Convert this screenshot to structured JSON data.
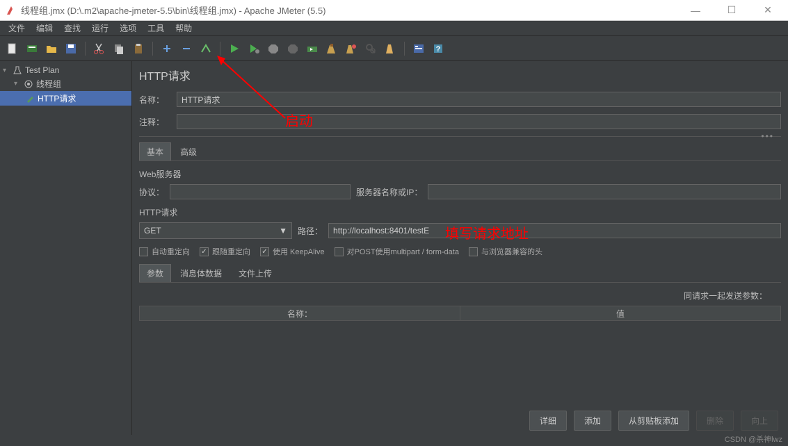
{
  "window": {
    "title": "线程组.jmx (D:\\.m2\\apache-jmeter-5.5\\bin\\线程组.jmx) - Apache JMeter (5.5)"
  },
  "menu": {
    "file": "文件",
    "edit": "编辑",
    "search": "查找",
    "run": "运行",
    "options": "选项",
    "tools": "工具",
    "help": "帮助"
  },
  "tree": {
    "testplan": "Test Plan",
    "threadgroup": "线程组",
    "httprequest": "HTTP请求"
  },
  "panel": {
    "title": "HTTP请求",
    "name_label": "名称：",
    "name_value": "HTTP请求",
    "comments_label": "注释：",
    "comments_value": ""
  },
  "tabs": {
    "basic": "基本",
    "advanced": "高级"
  },
  "webserver": {
    "section": "Web服务器",
    "protocol_label": "协议：",
    "protocol_value": "",
    "server_label": "服务器名称或IP：",
    "server_value": ""
  },
  "httpreq": {
    "section": "HTTP请求",
    "method": "GET",
    "path_label": "路径：",
    "path_value": "http://localhost:8401/testE"
  },
  "checkboxes": {
    "auto_redirect": "自动重定向",
    "follow_redirect": "跟随重定向",
    "keepalive": "使用 KeepAlive",
    "multipart": "对POST使用multipart / form-data",
    "browser_compat": "与浏览器兼容的头"
  },
  "param_tabs": {
    "params": "参数",
    "body": "消息体数据",
    "files": "文件上传"
  },
  "params": {
    "send_with": "同请求一起发送参数：",
    "col_name": "名称：",
    "col_value": "值"
  },
  "buttons": {
    "detail": "详细",
    "add": "添加",
    "from_clipboard": "从剪贴板添加",
    "delete": "删除",
    "up": "向上"
  },
  "annotations": {
    "start": "启动",
    "url": "填写请求地址"
  },
  "watermark": "CSDN @杀神lwz"
}
